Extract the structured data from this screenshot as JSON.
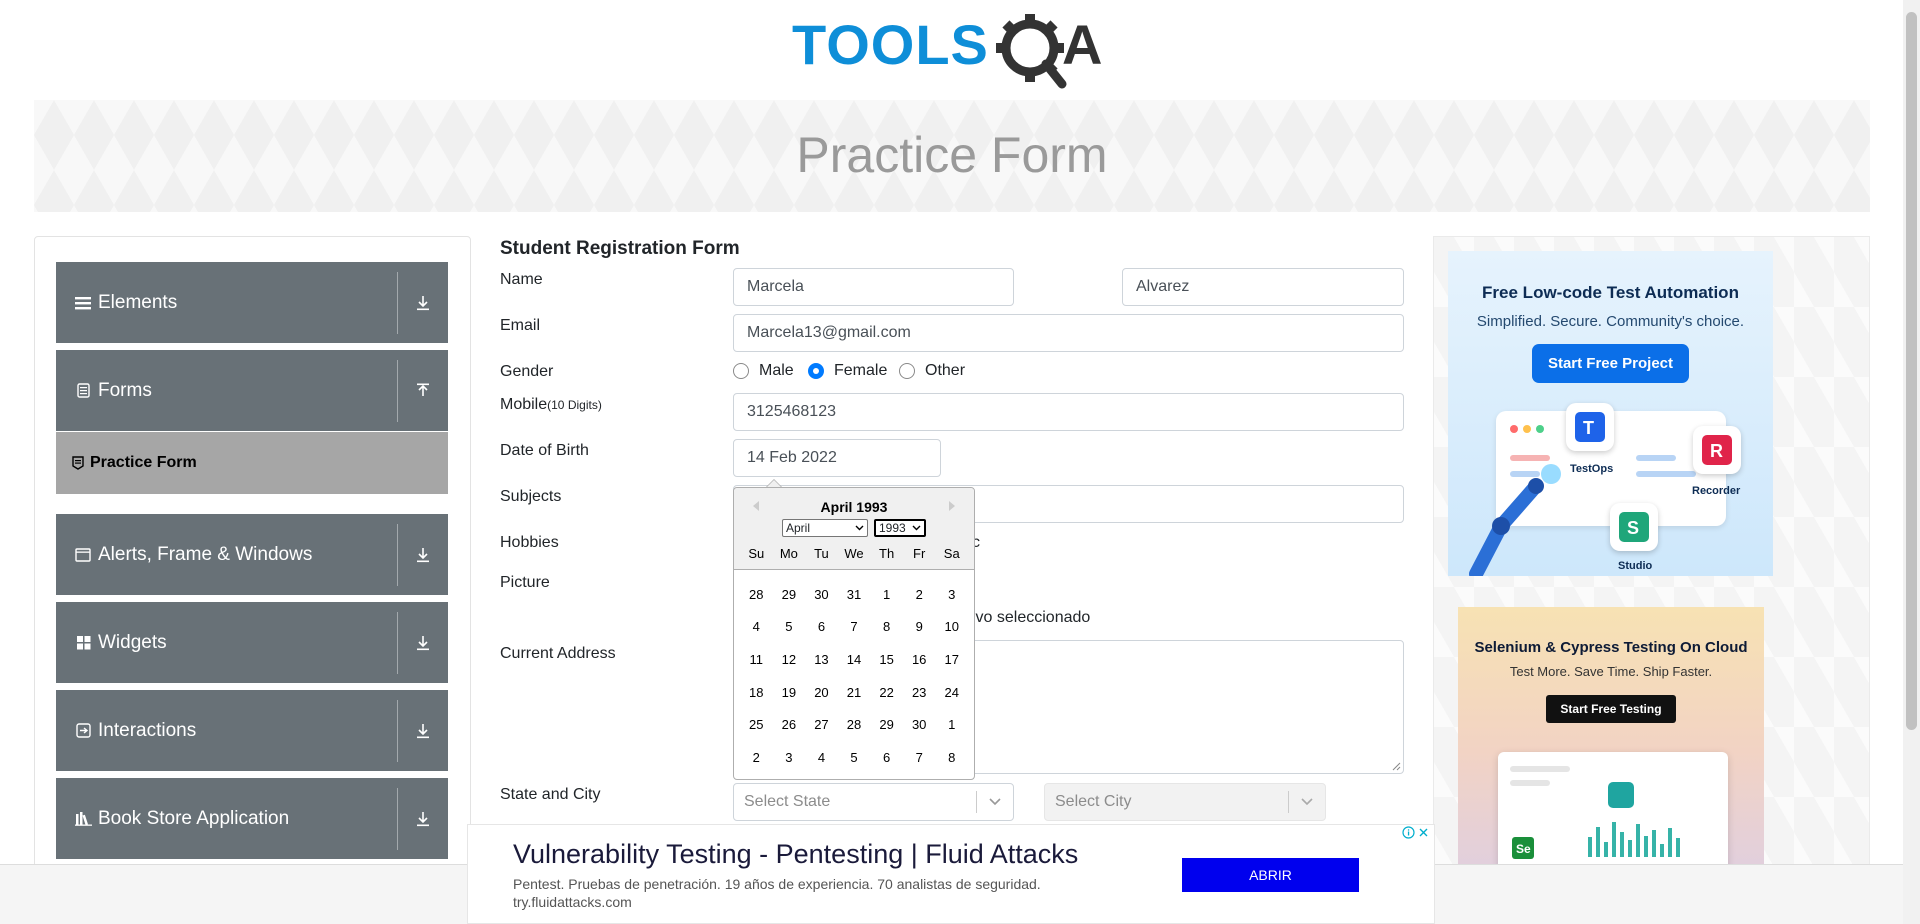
{
  "logo": {
    "text_left": "TOOLS",
    "text_right": "A",
    "brand_blue": "#0e8ed8",
    "brand_dark": "#333333"
  },
  "banner": {
    "title": "Practice Form"
  },
  "sidebar": {
    "groups": [
      {
        "label": "Elements",
        "icon": "hamburger-icon"
      },
      {
        "label": "Forms",
        "icon": "document-icon",
        "expanded": true
      },
      {
        "label": "Alerts, Frame & Windows",
        "icon": "window-icon"
      },
      {
        "label": "Widgets",
        "icon": "grid-icon"
      },
      {
        "label": "Interactions",
        "icon": "interaction-icon"
      },
      {
        "label": "Book Store Application",
        "icon": "books-icon"
      }
    ],
    "active_item": {
      "label": "Practice Form",
      "icon": "form-icon"
    }
  },
  "form": {
    "title": "Student Registration Form",
    "labels": {
      "name": "Name",
      "email": "Email",
      "gender": "Gender",
      "mobile": "Mobile",
      "mobile_hint": "(10 Digits)",
      "dob": "Date of Birth",
      "subjects": "Subjects",
      "hobbies": "Hobbies",
      "picture": "Picture",
      "address": "Current Address",
      "state_city": "State and City"
    },
    "first_name": "Marcela",
    "last_name": "Alvarez",
    "email": "Marcela13@gmail.com",
    "gender_options": [
      "Male",
      "Female",
      "Other"
    ],
    "gender_selected": "Female",
    "mobile": "3125468123",
    "dob": "14 Feb 2022",
    "hobbies_partial": "c",
    "picture_status_partial": "ivo seleccionado",
    "state_placeholder": "Select State",
    "city_placeholder": "Select City"
  },
  "datepicker": {
    "header": "April 1993",
    "month_select": "April",
    "year_select": "1993",
    "weekdays": [
      "Su",
      "Mo",
      "Tu",
      "We",
      "Th",
      "Fr",
      "Sa"
    ],
    "weeks": [
      [
        "28",
        "29",
        "30",
        "31",
        "1",
        "2",
        "3"
      ],
      [
        "4",
        "5",
        "6",
        "7",
        "8",
        "9",
        "10"
      ],
      [
        "11",
        "12",
        "13",
        "14",
        "15",
        "16",
        "17"
      ],
      [
        "18",
        "19",
        "20",
        "21",
        "22",
        "23",
        "24"
      ],
      [
        "25",
        "26",
        "27",
        "28",
        "29",
        "30",
        "1"
      ],
      [
        "2",
        "3",
        "4",
        "5",
        "6",
        "7",
        "8"
      ]
    ]
  },
  "ads": {
    "ad1": {
      "title": "Free Low-code Test Automation",
      "subtitle": "Simplified. Secure. Community's choice.",
      "button": "Start Free Project",
      "labels": [
        "TestOps",
        "Recorder",
        "Studio"
      ]
    },
    "ad2": {
      "title": "Selenium & Cypress Testing On Cloud",
      "subtitle": "Test More. Save Time. Ship Faster.",
      "button": "Start Free Testing"
    },
    "bottom": {
      "headline": "Vulnerability Testing - Pentesting | Fluid Attacks",
      "description": "Pentest. Pruebas de penetración. 19 años de experiencia. 70 analistas de seguridad.",
      "url": "try.fluidattacks.com",
      "button": "ABRIR"
    }
  }
}
